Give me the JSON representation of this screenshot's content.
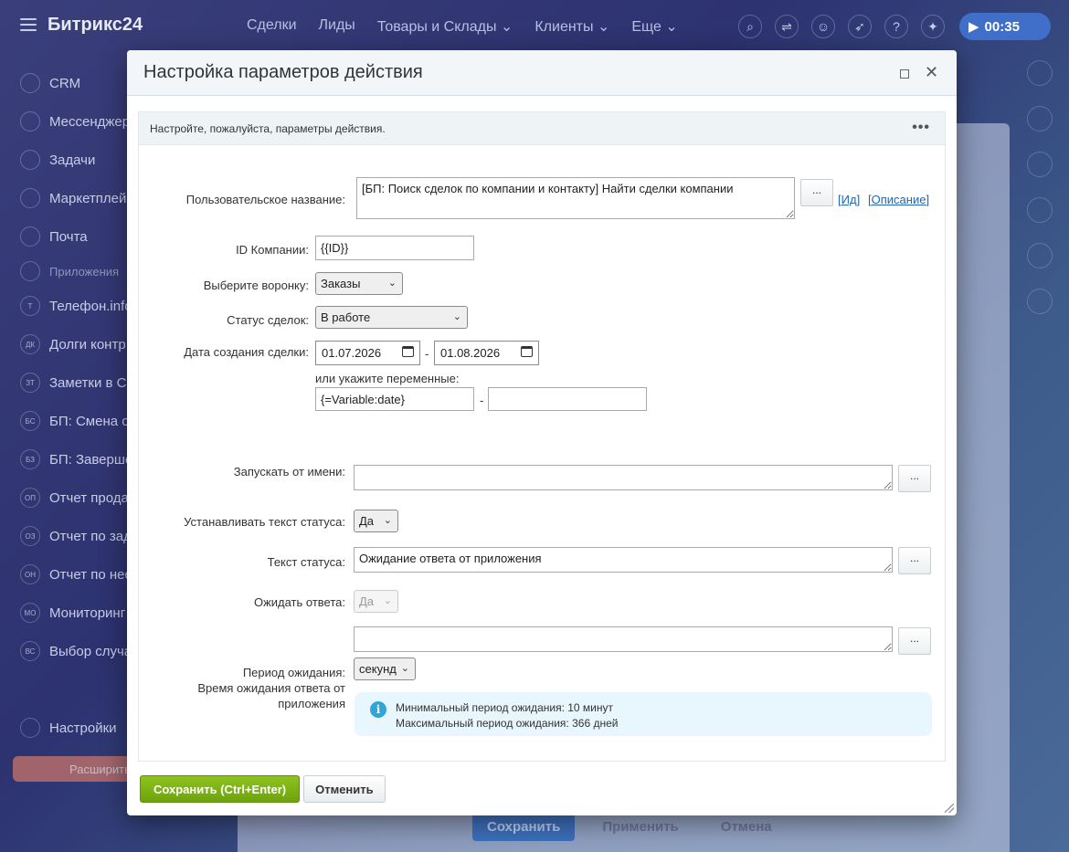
{
  "app": {
    "logo": "Битрикс24",
    "nav": [
      "Сделки",
      "Лиды",
      "Товары и Склады ⌄",
      "Клиенты ⌄",
      "Еще ⌄"
    ],
    "timer": "00:35",
    "sidebar": [
      {
        "label": "CRM",
        "badge": ""
      },
      {
        "label": "Мессенджер",
        "badge": ""
      },
      {
        "label": "Задачи",
        "badge": ""
      },
      {
        "label": "Маркетплейс",
        "badge": ""
      },
      {
        "label": "Почта",
        "badge": ""
      },
      {
        "label": "Приложения",
        "badge": ""
      },
      {
        "label": "Телефон.info",
        "badge": "Т"
      },
      {
        "label": "Долги контр",
        "badge": "ДК"
      },
      {
        "label": "Заметки в CR",
        "badge": "ЗТ"
      },
      {
        "label": "БП: Смена о",
        "badge": "БС"
      },
      {
        "label": "БП: Заверше",
        "badge": "БЗ"
      },
      {
        "label": "Отчет прода",
        "badge": "ОП"
      },
      {
        "label": "Отчет по зад",
        "badge": "ОЗ"
      },
      {
        "label": "Отчет по нес",
        "badge": "ОН"
      },
      {
        "label": "Мониторинг",
        "badge": "МО"
      },
      {
        "label": "Выбор случа",
        "badge": "ВС"
      }
    ],
    "settings": "Настройки",
    "expand": "Расширить",
    "bg_buttons": {
      "save": "Сохранить",
      "apply": "Применить",
      "cancel": "Отмена"
    }
  },
  "dialog": {
    "title": "Настройка параметров действия",
    "intro": "Настройте, пожалуйста, параметры действия.",
    "more": "•••",
    "fields": {
      "custom_name": {
        "label": "Пользовательское название:",
        "value": "[БП: Поиск сделок по компании и контакту] Найти сделки компании",
        "id_link": "Ид",
        "desc_link": "Описание"
      },
      "company_id": {
        "label": "ID Компании:",
        "value": "{{ID}}"
      },
      "funnel": {
        "label": "Выберите воронку:",
        "value": "Заказы"
      },
      "status": {
        "label": "Статус сделок:",
        "value": "В работе"
      },
      "created": {
        "label": "Дата создания сделки:",
        "from": "01.07.2026",
        "to": "01.08.2026",
        "vars_hint": "или укажите переменные:",
        "var_from": "{=Variable:date}",
        "var_to": ""
      },
      "run_as": {
        "label": "Запускать от имени:",
        "value": ""
      },
      "set_status": {
        "label": "Устанавливать текст статуса:",
        "value": "Да"
      },
      "status_text": {
        "label": "Текст статуса:",
        "value": "Ожидание ответа от приложения"
      },
      "wait_answer": {
        "label": "Ожидать ответа:",
        "value": "Да"
      },
      "wait_period": {
        "label": "Период ожидания:",
        "sublabel": "Время ожидания ответа от приложения",
        "value": "",
        "unit": "секунд"
      }
    },
    "info": {
      "line1": "Минимальный период ожидания: 10 минут",
      "line2": "Максимальный период ожидания: 366 дней"
    },
    "dots": "...",
    "buttons": {
      "save": "Сохранить (Ctrl+Enter)",
      "cancel": "Отменить"
    }
  }
}
